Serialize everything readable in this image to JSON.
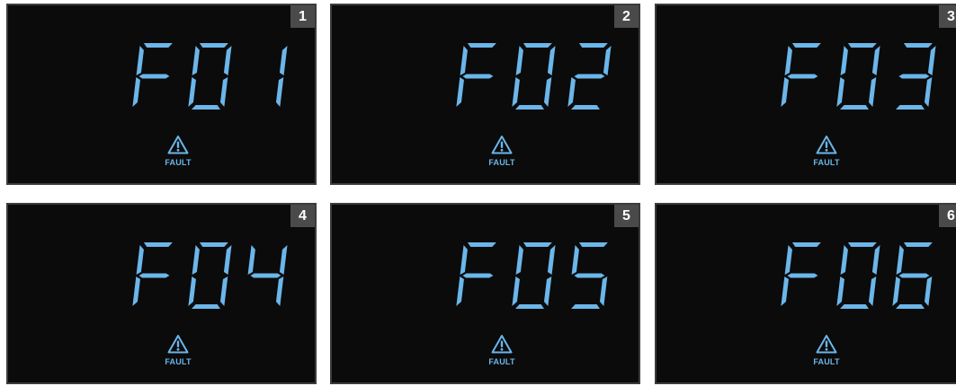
{
  "colors": {
    "display_digit": "#6bb6ea",
    "panel_background": "#0b0b0b",
    "badge_background": "#4a4a4a",
    "badge_text": "#ffffff"
  },
  "panels": [
    {
      "number": "1",
      "code": "F01",
      "indicator_label": "FAULT",
      "indicator_icon": "warning-triangle-icon"
    },
    {
      "number": "2",
      "code": "F02",
      "indicator_label": "FAULT",
      "indicator_icon": "warning-triangle-icon"
    },
    {
      "number": "3",
      "code": "F03",
      "indicator_label": "FAULT",
      "indicator_icon": "warning-triangle-icon"
    },
    {
      "number": "4",
      "code": "F04",
      "indicator_label": "FAULT",
      "indicator_icon": "warning-triangle-icon"
    },
    {
      "number": "5",
      "code": "F05",
      "indicator_label": "FAULT",
      "indicator_icon": "warning-triangle-icon"
    },
    {
      "number": "6",
      "code": "F06",
      "indicator_label": "FAULT",
      "indicator_icon": "warning-triangle-icon"
    }
  ]
}
